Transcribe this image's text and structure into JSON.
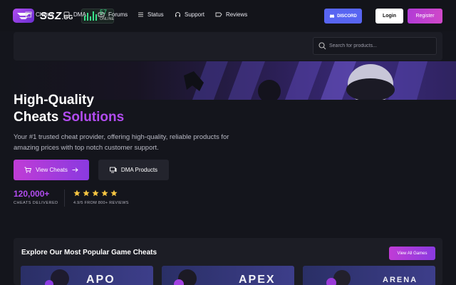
{
  "header": {
    "logo_text": "SSZ",
    "logo_suffix": ".GG",
    "online_count": "57",
    "online_label": "ONLINE",
    "discord_label": "DISCORD",
    "login_label": "Login",
    "register_label": "Register"
  },
  "nav": {
    "items": [
      {
        "label": "Cheats",
        "icon": "store-icon"
      },
      {
        "label": "DMA",
        "icon": "hard-drive-icon"
      },
      {
        "label": "Forums",
        "icon": "forum-icon"
      },
      {
        "label": "Status",
        "icon": "list-status-icon"
      },
      {
        "label": "Support",
        "icon": "headset-icon"
      },
      {
        "label": "Reviews",
        "icon": "reviews-icon"
      }
    ],
    "search_placeholder": "Search for products..."
  },
  "hero": {
    "title_line1": "High-Quality",
    "title_line2_white": "Cheats ",
    "title_line2_accent": "Solutions",
    "description": "Your #1 trusted cheat provider, offering high-quality, reliable products for amazing prices with top notch customer support.",
    "primary_button": "View Cheats",
    "secondary_button": "DMA Products",
    "stat_value": "120,000+",
    "stat_label": "CHEATS DELIVERED",
    "stars": 5,
    "rating_text": "4.9/5 FROM 800+ REVIEWS"
  },
  "popular": {
    "title": "Explore Our Most Popular Game Cheats",
    "view_all_label": "View All Games",
    "cards": [
      {
        "title": "APO"
      },
      {
        "title": "APEX"
      },
      {
        "title": "ARENA"
      }
    ]
  },
  "colors": {
    "accent": "#b24cf0",
    "discord": "#5865f2",
    "background": "#14151c",
    "panel": "#1c1d25",
    "online_green": "#3be08a",
    "star": "#f5c542"
  }
}
